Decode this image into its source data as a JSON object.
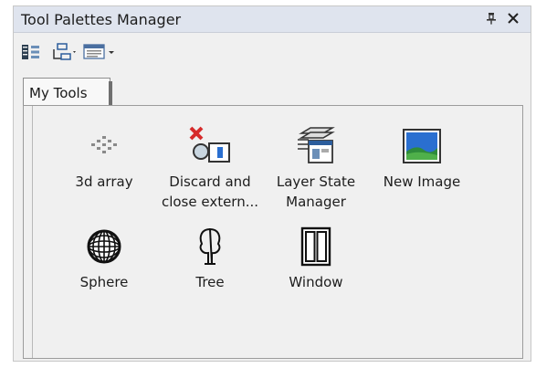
{
  "window": {
    "title": "Tool Palettes Manager",
    "pin_label": " ",
    "close_label": "✕"
  },
  "toolbar": {
    "icons": [
      "tree-view-icon",
      "hierarchy-icon",
      "view-options-icon"
    ]
  },
  "tabs": [
    {
      "label": "My Tools",
      "active": true
    }
  ],
  "tools": [
    {
      "name": "3d array",
      "icon": "3d-array-icon"
    },
    {
      "name": "Discard and close extern...",
      "icon": "discard-close-xref-icon"
    },
    {
      "name": "Layer State Manager",
      "icon": "layer-state-manager-icon"
    },
    {
      "name": "New Image",
      "icon": "new-image-icon"
    },
    {
      "name": "Sphere",
      "icon": "sphere-icon"
    },
    {
      "name": "Tree",
      "icon": "tree-icon"
    },
    {
      "name": "Window",
      "icon": "window-icon"
    }
  ],
  "colors": {
    "title_bar": "#dfe4ee",
    "panel": "#f0f0f0",
    "delete_red": "#d62b2b",
    "image_blue": "#2a6fd0",
    "image_green": "#2e8b3b"
  }
}
